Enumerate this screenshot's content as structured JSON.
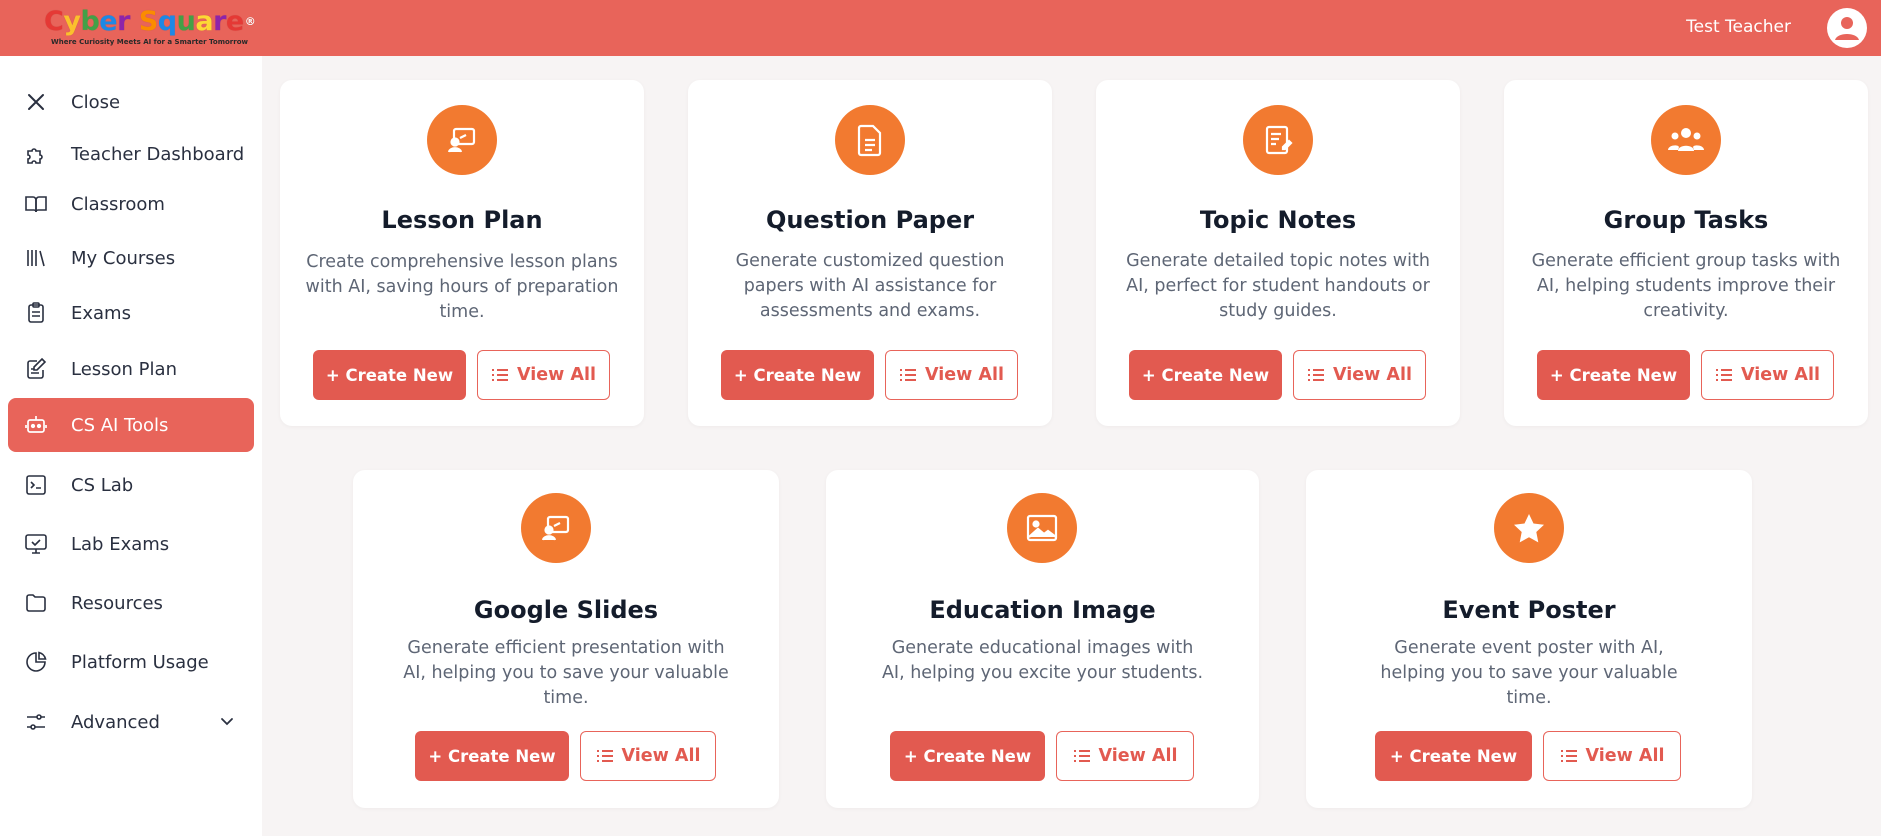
{
  "header": {
    "logo_letters": [
      "C",
      "y",
      "b",
      "e",
      "r",
      " ",
      "S",
      "q",
      "u",
      "a",
      "r",
      "e"
    ],
    "logo_reg": "®",
    "tagline": "Where Curiosity Meets AI for a Smarter Tomorrow",
    "user_name": "Test Teacher",
    "background_color": "#e8645a"
  },
  "sidebar": {
    "items": [
      {
        "label": "Close",
        "icon": "close-icon"
      },
      {
        "label": "Teacher Dashboard",
        "icon": "puzzle-icon"
      },
      {
        "label": "Classroom",
        "icon": "book-open-icon"
      },
      {
        "label": "My Courses",
        "icon": "library-icon"
      },
      {
        "label": "Exams",
        "icon": "clipboard-icon"
      },
      {
        "label": "Lesson Plan",
        "icon": "notepad-edit-icon"
      },
      {
        "label": "CS AI Tools",
        "icon": "robot-icon",
        "active": true
      },
      {
        "label": "CS Lab",
        "icon": "terminal-icon"
      },
      {
        "label": "Lab Exams",
        "icon": "monitor-check-icon"
      },
      {
        "label": "Resources",
        "icon": "folder-icon"
      },
      {
        "label": "Platform Usage",
        "icon": "pie-chart-icon"
      },
      {
        "label": "Advanced",
        "icon": "sliders-icon"
      }
    ]
  },
  "cards": [
    {
      "title": "Lesson Plan",
      "desc_lines": [
        "Create comprehensive lesson plans",
        "with AI, saving hours of preparation",
        "time."
      ],
      "create": "+ Create New",
      "view": "View All",
      "icon": "presentation-icon"
    },
    {
      "title": "Question Paper",
      "desc_lines": [
        "Generate customized question",
        "papers with AI assistance for",
        "assessments and exams."
      ],
      "create": "+ Create New",
      "view": "View All",
      "icon": "document-icon"
    },
    {
      "title": "Topic Notes",
      "desc_lines": [
        "Generate detailed topic notes with",
        "AI, perfect for student handouts or",
        "study guides."
      ],
      "create": "+ Create New",
      "view": "View All",
      "icon": "notes-icon"
    },
    {
      "title": "Group Tasks",
      "desc_lines": [
        "Generate efficient group tasks with",
        "AI, helping students improve their",
        "creativity."
      ],
      "create": "+ Create New",
      "view": "View All",
      "icon": "group-icon"
    },
    {
      "title": "Google Slides",
      "desc_lines": [
        "Generate efficient presentation with",
        "AI, helping you to save your valuable",
        "time."
      ],
      "create": "+ Create New",
      "view": "View All",
      "icon": "presentation-icon"
    },
    {
      "title": "Education Image",
      "desc_lines": [
        "Generate educational images with",
        "AI, helping you excite your students."
      ],
      "create": "+ Create New",
      "view": "View All",
      "icon": "image-icon"
    },
    {
      "title": "Event Poster",
      "desc_lines": [
        "Generate event poster with AI,",
        "helping you to save your valuable",
        "time."
      ],
      "create": "+ Create New",
      "view": "View All",
      "icon": "star-icon"
    }
  ],
  "colors": {
    "accent": "#e25a50",
    "icon_circle": "#f27a30",
    "active_nav": "#e8645a"
  }
}
